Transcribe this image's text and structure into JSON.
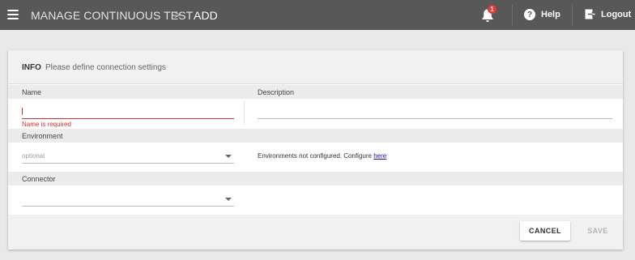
{
  "header": {
    "breadcrumb_parent": "MANAGE CONTINUOUS TEST",
    "breadcrumb_separator": ">",
    "breadcrumb_current": "ADD",
    "notification_count": "1",
    "help_label": "Help",
    "logout_label": "Logout",
    "help_glyph": "?"
  },
  "form": {
    "section_title": "INFO",
    "section_subtitle": "Please define connection settings",
    "name_label": "Name",
    "name_value": "",
    "name_error": "Name is required",
    "description_label": "Description",
    "environment_label": "Environment",
    "environment_placeholder": "optional",
    "environment_message": "Environments not configured. Configure",
    "environment_link": "here",
    "connector_label": "Connector",
    "connector_value": ""
  },
  "actions": {
    "cancel_label": "CANCEL",
    "save_label": "SAVE"
  },
  "colors": {
    "topbar": "#585858",
    "error": "#d32f2f",
    "badge": "#e53935",
    "link": "#1a0dab"
  },
  "icons": {
    "menu": "hamburger-icon",
    "notifications": "bell-icon",
    "help": "help-circle-icon",
    "logout": "logout-icon",
    "dropdown": "chevron-down-icon"
  }
}
